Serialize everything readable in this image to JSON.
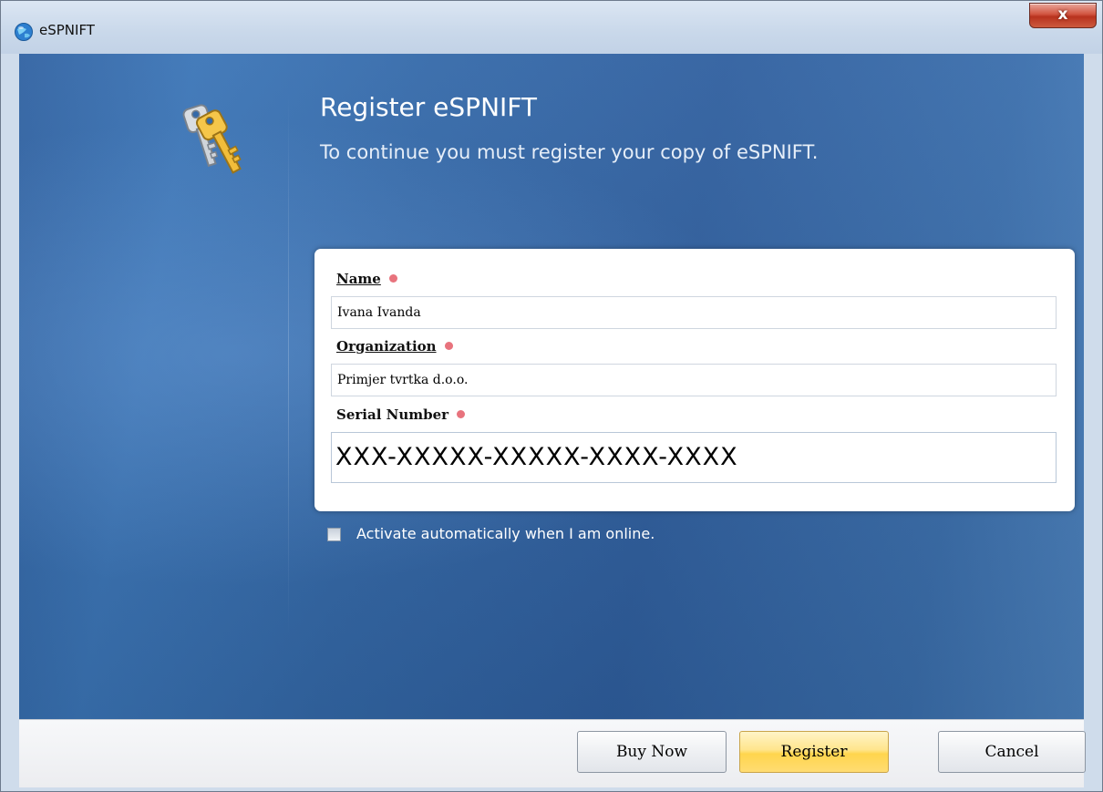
{
  "window": {
    "title": "eSPNIFT",
    "close_glyph": "x"
  },
  "icons": {
    "app": "app-globe-icon",
    "keys": "keys-icon",
    "close": "close-icon"
  },
  "header": {
    "title": "Register eSPNIFT",
    "subtitle": "To continue you must register your copy of eSPNIFT."
  },
  "form": {
    "name_label": "Name",
    "name_value": "Ivana Ivanda",
    "organization_label": "Organization",
    "organization_value": "Primjer tvrtka d.o.o.",
    "serial_label": "Serial Number",
    "serial_value": "XXX-XXXXX-XXXXX-XXXX-XXXX"
  },
  "activate": {
    "label": "Activate automatically when I am online.",
    "checked": false
  },
  "buttons": {
    "buy_now": "Buy Now",
    "register": "Register",
    "cancel": "Cancel"
  },
  "colors": {
    "accent": "#3468a8",
    "required": "#e8737d",
    "primary_button": "#ffd54d"
  }
}
